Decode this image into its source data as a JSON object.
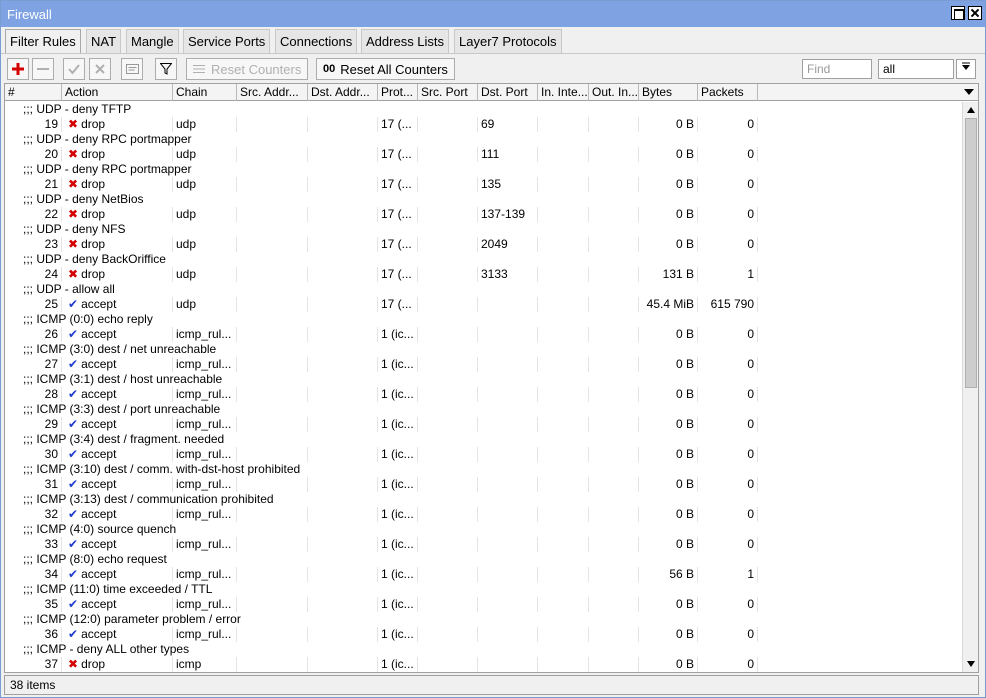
{
  "window": {
    "title": "Firewall"
  },
  "tabs": [
    "Filter Rules",
    "NAT",
    "Mangle",
    "Service Ports",
    "Connections",
    "Address Lists",
    "Layer7 Protocols"
  ],
  "toolbar": {
    "reset_counters": "Reset Counters",
    "reset_all_counters": "Reset All Counters",
    "reset_all_icon": "00",
    "find_placeholder": "Find",
    "filter_value": "all"
  },
  "columns": [
    "#",
    "Action",
    "Chain",
    "Src. Addr...",
    "Dst. Addr...",
    "Prot...",
    "Src. Port",
    "Dst. Port",
    "In. Inte...",
    "Out. In...",
    "Bytes",
    "Packets"
  ],
  "rows": [
    {
      "comment": ";;; UDP - deny TFTP",
      "num": "19",
      "action": "drop",
      "chain": "udp",
      "proto": "17 (...",
      "dst_port": "69",
      "bytes": "0 B",
      "packets": "0"
    },
    {
      "comment": ";;; UDP - deny RPC portmapper",
      "num": "20",
      "action": "drop",
      "chain": "udp",
      "proto": "17 (...",
      "dst_port": "111",
      "bytes": "0 B",
      "packets": "0"
    },
    {
      "comment": ";;; UDP - deny RPC portmapper",
      "num": "21",
      "action": "drop",
      "chain": "udp",
      "proto": "17 (...",
      "dst_port": "135",
      "bytes": "0 B",
      "packets": "0"
    },
    {
      "comment": ";;; UDP - deny NetBios",
      "num": "22",
      "action": "drop",
      "chain": "udp",
      "proto": "17 (...",
      "dst_port": "137-139",
      "bytes": "0 B",
      "packets": "0"
    },
    {
      "comment": ";;; UDP - deny NFS",
      "num": "23",
      "action": "drop",
      "chain": "udp",
      "proto": "17 (...",
      "dst_port": "2049",
      "bytes": "0 B",
      "packets": "0"
    },
    {
      "comment": ";;; UDP - deny BackOriffice",
      "num": "24",
      "action": "drop",
      "chain": "udp",
      "proto": "17 (...",
      "dst_port": "3133",
      "bytes": "131 B",
      "packets": "1"
    },
    {
      "comment": ";;; UDP - allow all",
      "num": "25",
      "action": "accept",
      "chain": "udp",
      "proto": "17 (...",
      "dst_port": "",
      "bytes": "45.4 MiB",
      "packets": "615 790"
    },
    {
      "comment": ";;; ICMP (0:0) echo reply",
      "num": "26",
      "action": "accept",
      "chain": "icmp_rul...",
      "proto": "1 (ic...",
      "dst_port": "",
      "bytes": "0 B",
      "packets": "0"
    },
    {
      "comment": ";;; ICMP (3:0) dest / net unreachable",
      "num": "27",
      "action": "accept",
      "chain": "icmp_rul...",
      "proto": "1 (ic...",
      "dst_port": "",
      "bytes": "0 B",
      "packets": "0"
    },
    {
      "comment": ";;; ICMP (3:1) dest / host unreachable",
      "num": "28",
      "action": "accept",
      "chain": "icmp_rul...",
      "proto": "1 (ic...",
      "dst_port": "",
      "bytes": "0 B",
      "packets": "0"
    },
    {
      "comment": ";;; ICMP (3:3) dest / port unreachable",
      "num": "29",
      "action": "accept",
      "chain": "icmp_rul...",
      "proto": "1 (ic...",
      "dst_port": "",
      "bytes": "0 B",
      "packets": "0"
    },
    {
      "comment": ";;; ICMP (3:4) dest / fragment. needed",
      "num": "30",
      "action": "accept",
      "chain": "icmp_rul...",
      "proto": "1 (ic...",
      "dst_port": "",
      "bytes": "0 B",
      "packets": "0"
    },
    {
      "comment": ";;; ICMP (3:10) dest / comm. with-dst-host prohibited",
      "num": "31",
      "action": "accept",
      "chain": "icmp_rul...",
      "proto": "1 (ic...",
      "dst_port": "",
      "bytes": "0 B",
      "packets": "0"
    },
    {
      "comment": ";;; ICMP (3:13) dest / communication prohibited",
      "num": "32",
      "action": "accept",
      "chain": "icmp_rul...",
      "proto": "1 (ic...",
      "dst_port": "",
      "bytes": "0 B",
      "packets": "0"
    },
    {
      "comment": ";;; ICMP (4:0) source quench",
      "num": "33",
      "action": "accept",
      "chain": "icmp_rul...",
      "proto": "1 (ic...",
      "dst_port": "",
      "bytes": "0 B",
      "packets": "0"
    },
    {
      "comment": ";;; ICMP (8:0) echo request",
      "num": "34",
      "action": "accept",
      "chain": "icmp_rul...",
      "proto": "1 (ic...",
      "dst_port": "",
      "bytes": "56 B",
      "packets": "1"
    },
    {
      "comment": ";;; ICMP (11:0) time exceeded / TTL",
      "num": "35",
      "action": "accept",
      "chain": "icmp_rul...",
      "proto": "1 (ic...",
      "dst_port": "",
      "bytes": "0 B",
      "packets": "0"
    },
    {
      "comment": ";;; ICMP (12:0) parameter problem / error",
      "num": "36",
      "action": "accept",
      "chain": "icmp_rul...",
      "proto": "1 (ic...",
      "dst_port": "",
      "bytes": "0 B",
      "packets": "0"
    },
    {
      "comment": ";;; ICMP - deny ALL other types",
      "num": "37",
      "action": "drop",
      "chain": "icmp",
      "proto": "1 (ic...",
      "dst_port": "",
      "bytes": "0 B",
      "packets": "0"
    }
  ],
  "status": {
    "count": "38 items"
  },
  "colors": {
    "title_bar": "#7fa2e3",
    "drop_icon": "#d40000",
    "accept_icon": "#1e3ccf"
  }
}
